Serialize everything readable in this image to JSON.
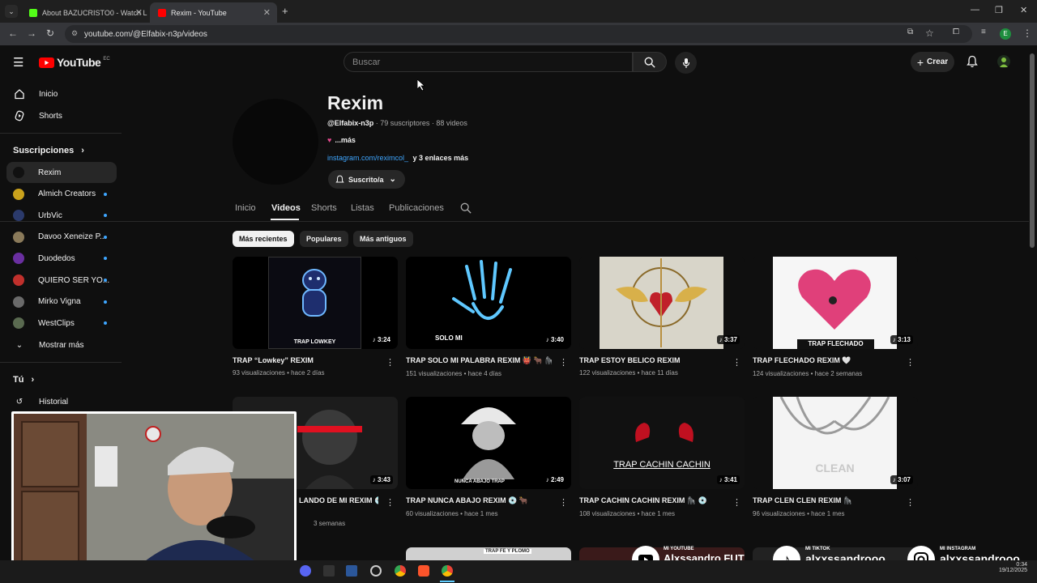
{
  "browser": {
    "tabs": [
      {
        "title": "About BAZUCRISTO0 - Watch L",
        "active": false
      },
      {
        "title": "Rexim - YouTube",
        "active": true
      }
    ],
    "url": "youtube.com/@Elfabix-n3p/videos",
    "profile_initial": "E"
  },
  "youtube": {
    "logo_text": "YouTube",
    "country_code": "EC",
    "search_placeholder": "Buscar",
    "create_label": "Crear"
  },
  "sidebar": {
    "top": [
      {
        "label": "Inicio",
        "icon": "home-icon"
      },
      {
        "label": "Shorts",
        "icon": "shorts-icon"
      }
    ],
    "subs_heading": "Suscripciones",
    "subscriptions": [
      {
        "label": "Rexim",
        "color": "#111111",
        "selected": true,
        "dot": false
      },
      {
        "label": "Almich Creators",
        "color": "#caa21c",
        "dot": true
      },
      {
        "label": "UrbVic",
        "color": "#2b3a6b",
        "dot": true
      },
      {
        "label": "Davoo Xeneize P...",
        "color": "#8a7a5a",
        "dot": true
      },
      {
        "label": "Duodedos",
        "color": "#6a2fa0",
        "dot": true
      },
      {
        "label": "QUIERO SER YO...",
        "color": "#c0302c",
        "dot": true
      },
      {
        "label": "Mirko Vigna",
        "color": "#6a6a6a",
        "dot": true
      },
      {
        "label": "WestClips",
        "color": "#5a6a50",
        "dot": true
      }
    ],
    "show_more": "Mostrar más",
    "you_heading": "Tú",
    "history": "Historial"
  },
  "channel": {
    "name": "Rexim",
    "handle": "@Elfabix-n3p",
    "stats": " · 79 suscriptores · 88 videos",
    "desc_more": "...más",
    "link": "instagram.com/reximcol_",
    "link_more": "y 3 enlaces más",
    "subscribed_label": "Suscrito/a",
    "tabs": [
      "Inicio",
      "Videos",
      "Shorts",
      "Listas",
      "Publicaciones"
    ],
    "active_tab": "Videos",
    "chips": [
      "Más recientes",
      "Populares",
      "Más antiguos"
    ]
  },
  "videos": [
    {
      "title": "TRAP “Lowkey” REXIM",
      "meta": "93 visualizaciones • hace 2 días",
      "duration": "3:24",
      "thumb_text": "TRAP LOWKEY"
    },
    {
      "title": "TRAP SOLO MI PALABRA REXIM 👹 🐂 🦍",
      "meta": "151 visualizaciones • hace 4 días",
      "duration": "3:40",
      "thumb_text": "SOLO MI"
    },
    {
      "title": "TRAP ESTOY BELICO REXIM",
      "meta": "122 visualizaciones • hace 11 días",
      "duration": "3:37",
      "thumb_text": ""
    },
    {
      "title": "TRAP FLECHADO REXIM 🤍",
      "meta": "124 visualizaciones • hace 2 semanas",
      "duration": "3:13",
      "thumb_text": "TRAP FLECHADO"
    },
    {
      "title": "LANDO DE MI REXIM 💿",
      "meta": "3 semanas",
      "duration": "3:43",
      "thumb_text": ""
    },
    {
      "title": "TRAP NUNCA ABAJO REXIM 💿 🐂",
      "meta": "60 visualizaciones • hace 1 mes",
      "duration": "2:49",
      "thumb_text": "NUNCA ABAJO TRAP"
    },
    {
      "title": "TRAP CACHIN CACHIN REXIM 🦍 💿",
      "meta": "108 visualizaciones • hace 1 mes",
      "duration": "3:41",
      "thumb_text": "TRAP CACHIN CACHIN"
    },
    {
      "title": "TRAP CLEN CLEN REXIM 🦍",
      "meta": "96 visualizaciones • hace 1 mes",
      "duration": "3:07",
      "thumb_text": "CLEAN"
    }
  ],
  "next_row_thumb_text": "TRAP FE Y PLOMO",
  "overlay": {
    "youtube_small": "MI YOUTUBE",
    "youtube_name": "Alxssandro FUT",
    "tiktok_small": "MI TIKTOK",
    "tiktok_name": "alxxssandrooo",
    "instagram_small": "MI INSTAGRAM",
    "instagram_name": "alxxssandrooo"
  },
  "taskbar": {
    "time": "0:34",
    "date": "19/12/2025"
  },
  "colors": {
    "bg": "#0f0f0f",
    "accent_red": "#ff0000",
    "link_blue": "#3ea6ff",
    "chip_selected": "#f1f1f1"
  }
}
